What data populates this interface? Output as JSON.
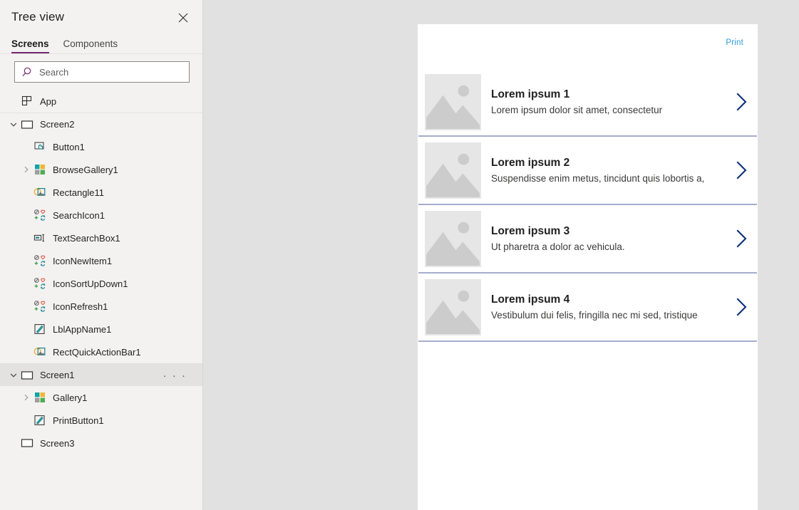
{
  "sidebar": {
    "title": "Tree view",
    "close_icon": "close-icon",
    "tabs": [
      {
        "label": "Screens",
        "active": true
      },
      {
        "label": "Components",
        "active": false
      }
    ],
    "search": {
      "placeholder": "Search",
      "value": "",
      "icon": "search-icon"
    },
    "tree": [
      {
        "label": "App",
        "level": 0,
        "icon": "app-icon",
        "expander": "none",
        "selected": false,
        "menu": false,
        "divider_above": false
      },
      {
        "label": "Screen2",
        "level": 1,
        "icon": "screen-icon",
        "expander": "expanded",
        "selected": false,
        "menu": false,
        "divider_above": true
      },
      {
        "label": "Button1",
        "level": 2,
        "icon": "button-icon",
        "expander": "none",
        "selected": false,
        "menu": false,
        "divider_above": false
      },
      {
        "label": "BrowseGallery1",
        "level": 2,
        "icon": "gallery-icon",
        "expander": "collapsed",
        "selected": false,
        "menu": false,
        "divider_above": false
      },
      {
        "label": "Rectangle11",
        "level": 2,
        "icon": "shape-icon",
        "expander": "none",
        "selected": false,
        "menu": false,
        "divider_above": false
      },
      {
        "label": "SearchIcon1",
        "level": 2,
        "icon": "icon-set-icon",
        "expander": "none",
        "selected": false,
        "menu": false,
        "divider_above": false
      },
      {
        "label": "TextSearchBox1",
        "level": 2,
        "icon": "textinput-icon",
        "expander": "none",
        "selected": false,
        "menu": false,
        "divider_above": false
      },
      {
        "label": "IconNewItem1",
        "level": 2,
        "icon": "icon-set-icon",
        "expander": "none",
        "selected": false,
        "menu": false,
        "divider_above": false
      },
      {
        "label": "IconSortUpDown1",
        "level": 2,
        "icon": "icon-set-icon",
        "expander": "none",
        "selected": false,
        "menu": false,
        "divider_above": false
      },
      {
        "label": "IconRefresh1",
        "level": 2,
        "icon": "icon-set-icon",
        "expander": "none",
        "selected": false,
        "menu": false,
        "divider_above": false
      },
      {
        "label": "LblAppName1",
        "level": 2,
        "icon": "label-icon",
        "expander": "none",
        "selected": false,
        "menu": false,
        "divider_above": false
      },
      {
        "label": "RectQuickActionBar1",
        "level": 2,
        "icon": "shape-icon",
        "expander": "none",
        "selected": false,
        "menu": false,
        "divider_above": false
      },
      {
        "label": "Screen1",
        "level": 1,
        "icon": "screen-icon",
        "expander": "expanded",
        "selected": true,
        "menu": true,
        "divider_above": true
      },
      {
        "label": "Gallery1",
        "level": 2,
        "icon": "gallery-icon",
        "expander": "collapsed",
        "selected": false,
        "menu": false,
        "divider_above": false
      },
      {
        "label": "PrintButton1",
        "level": 2,
        "icon": "label-icon",
        "expander": "none",
        "selected": false,
        "menu": false,
        "divider_above": false
      },
      {
        "label": "Screen3",
        "level": 1,
        "icon": "screen-icon",
        "expander": "none",
        "selected": false,
        "menu": false,
        "divider_above": false
      }
    ],
    "menu_glyph": "· · ·"
  },
  "canvas": {
    "print_link": "Print",
    "gallery": {
      "separator_color": "#a6adcd",
      "chevron_color": "#0d2f7d",
      "items": [
        {
          "title": "Lorem ipsum 1",
          "subtitle": "Lorem ipsum dolor sit amet, consectetur"
        },
        {
          "title": "Lorem ipsum 2",
          "subtitle": "Suspendisse enim metus, tincidunt quis lobortis a,"
        },
        {
          "title": "Lorem ipsum 3",
          "subtitle": "Ut pharetra a dolor ac vehicula."
        },
        {
          "title": "Lorem ipsum 4",
          "subtitle": "Vestibulum dui felis, fringilla nec mi sed, tristique"
        }
      ]
    }
  },
  "colors": {
    "accent_purple": "#742774",
    "link_blue": "#2e9bdd",
    "sidebar_bg": "#f3f2f1",
    "canvas_bg": "#e1e1e1",
    "selected_row": "#e3e2e1"
  }
}
